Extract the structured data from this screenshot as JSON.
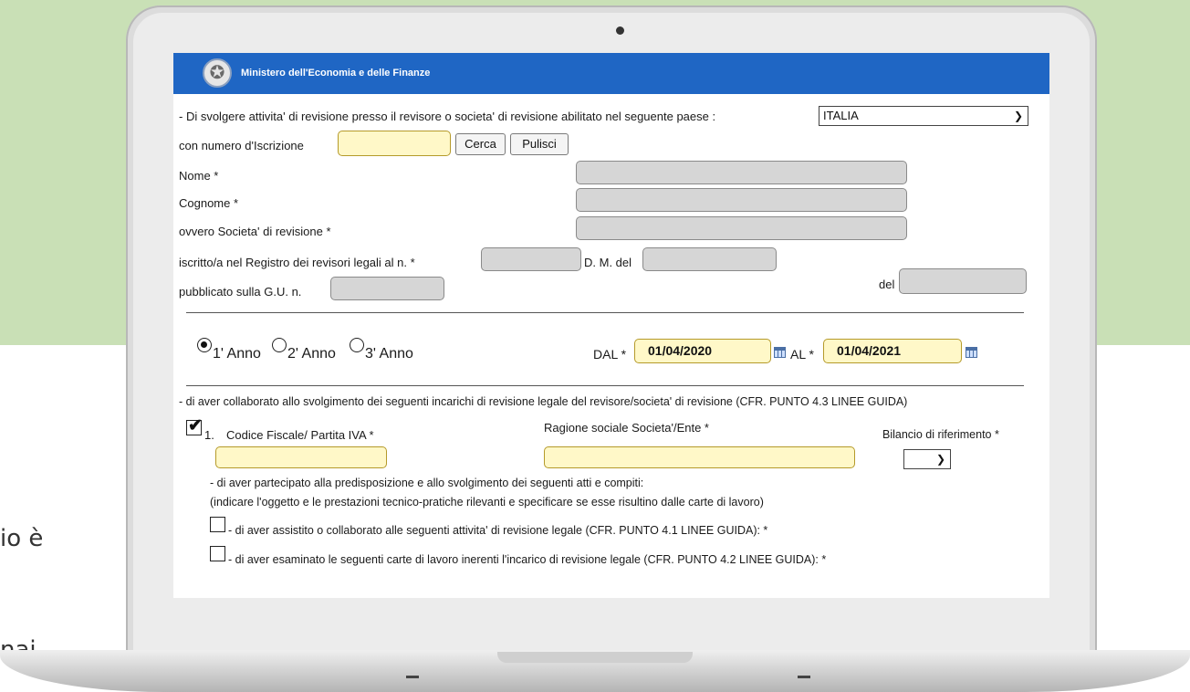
{
  "background_side_text": [
    "io è",
    "nai"
  ],
  "header": {
    "title": "Ministero dell'Economia e delle Finanze",
    "emblem_icon": "republic-emblem-icon"
  },
  "form": {
    "country_row_label": "- Di svolgere attivita' di revisione presso il revisore o societa' di revisione abilitato nel seguente paese :",
    "country_value": "ITALIA",
    "iscrizione_label": "con numero d'Iscrizione",
    "iscrizione_value": "",
    "search_button": "Cerca",
    "clear_button": "Pulisci",
    "nome_label": "Nome *",
    "cognome_label": "Cognome *",
    "societa_label": "ovvero Societa' di revisione *",
    "registro_label": "iscritto/a nel Registro dei revisori legali al n. *",
    "dm_label": "D. M. del",
    "gu_label": "pubblicato sulla G.U. n.",
    "del_label": "del"
  },
  "year": {
    "options": [
      "1' Anno",
      "2' Anno",
      "3' Anno"
    ],
    "selected_index": 0,
    "dal_label": "DAL *",
    "dal_value": "01/04/2020",
    "al_label": "AL *",
    "al_value": "01/04/2021"
  },
  "incarichi": {
    "intro": "- di aver collaborato allo svolgimento dei seguenti incarichi di revisione legale del revisore/societa' di revisione (CFR. PUNTO 4.3 LINEE GUIDA)",
    "item_number": "1.",
    "cf_label": "Codice Fiscale/ Partita IVA *",
    "ragione_label": "Ragione sociale Societa'/Ente *",
    "bilancio_label": "Bilancio di riferimento *",
    "checked": true,
    "partecipato_text": "- di aver partecipato alla predisposizione e allo svolgimento dei seguenti atti e compiti:",
    "indicare_text": "(indicare l'oggetto e le prestazioni tecnico-pratiche rilevanti e specificare se esse risultino dalle carte di lavoro)",
    "assistito_text": "- di aver assistito o collaborato alle seguenti attivita' di revisione legale (CFR. PUNTO 4.1 LINEE GUIDA): *",
    "esaminato_text": "- di aver esaminato le seguenti carte di lavoro inerenti l'incarico di revisione legale (CFR. PUNTO 4.2 LINEE GUIDA): *"
  }
}
